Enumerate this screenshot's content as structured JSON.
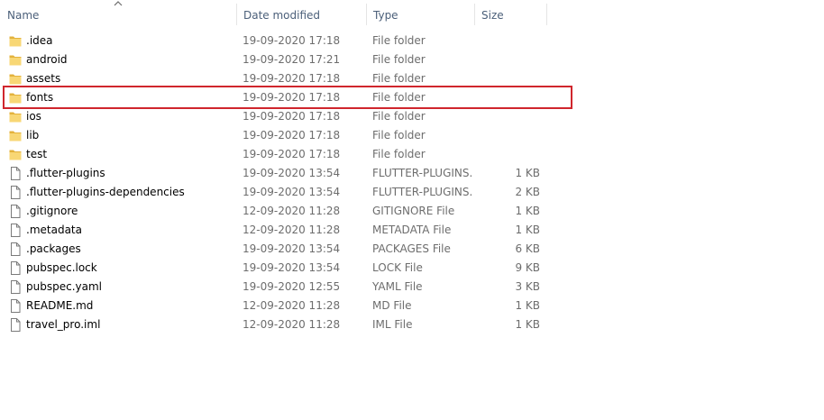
{
  "columns": {
    "name": "Name",
    "date_modified": "Date modified",
    "type": "Type",
    "size": "Size"
  },
  "sort": {
    "column": "name",
    "direction": "ascending"
  },
  "colors": {
    "folder": "#f8d775",
    "folder_dark": "#e3b23c",
    "highlight": "#d0262d",
    "header_text": "#4c607a"
  },
  "files": [
    {
      "name": ".idea",
      "date": "19-09-2020 17:18",
      "type": "File folder",
      "size": "",
      "icon": "folder-icon"
    },
    {
      "name": "android",
      "date": "19-09-2020 17:21",
      "type": "File folder",
      "size": "",
      "icon": "folder-icon"
    },
    {
      "name": "assets",
      "date": "19-09-2020 17:18",
      "type": "File folder",
      "size": "",
      "icon": "folder-icon"
    },
    {
      "name": "fonts",
      "date": "19-09-2020 17:18",
      "type": "File folder",
      "size": "",
      "icon": "folder-icon",
      "highlighted": true
    },
    {
      "name": "ios",
      "date": "19-09-2020 17:18",
      "type": "File folder",
      "size": "",
      "icon": "folder-icon"
    },
    {
      "name": "lib",
      "date": "19-09-2020 17:18",
      "type": "File folder",
      "size": "",
      "icon": "folder-icon"
    },
    {
      "name": "test",
      "date": "19-09-2020 17:18",
      "type": "File folder",
      "size": "",
      "icon": "folder-icon"
    },
    {
      "name": ".flutter-plugins",
      "date": "19-09-2020 13:54",
      "type": "FLUTTER-PLUGINS...",
      "size": "1 KB",
      "icon": "file-icon"
    },
    {
      "name": ".flutter-plugins-dependencies",
      "date": "19-09-2020 13:54",
      "type": "FLUTTER-PLUGINS...",
      "size": "2 KB",
      "icon": "file-icon"
    },
    {
      "name": ".gitignore",
      "date": "12-09-2020 11:28",
      "type": "GITIGNORE File",
      "size": "1 KB",
      "icon": "file-icon"
    },
    {
      "name": ".metadata",
      "date": "12-09-2020 11:28",
      "type": "METADATA File",
      "size": "1 KB",
      "icon": "file-icon"
    },
    {
      "name": ".packages",
      "date": "19-09-2020 13:54",
      "type": "PACKAGES File",
      "size": "6 KB",
      "icon": "file-icon"
    },
    {
      "name": "pubspec.lock",
      "date": "19-09-2020 13:54",
      "type": "LOCK File",
      "size": "9 KB",
      "icon": "file-icon"
    },
    {
      "name": "pubspec.yaml",
      "date": "19-09-2020 12:55",
      "type": "YAML File",
      "size": "3 KB",
      "icon": "file-icon"
    },
    {
      "name": "README.md",
      "date": "12-09-2020 11:28",
      "type": "MD File",
      "size": "1 KB",
      "icon": "file-icon"
    },
    {
      "name": "travel_pro.iml",
      "date": "12-09-2020 11:28",
      "type": "IML File",
      "size": "1 KB",
      "icon": "file-icon"
    }
  ]
}
